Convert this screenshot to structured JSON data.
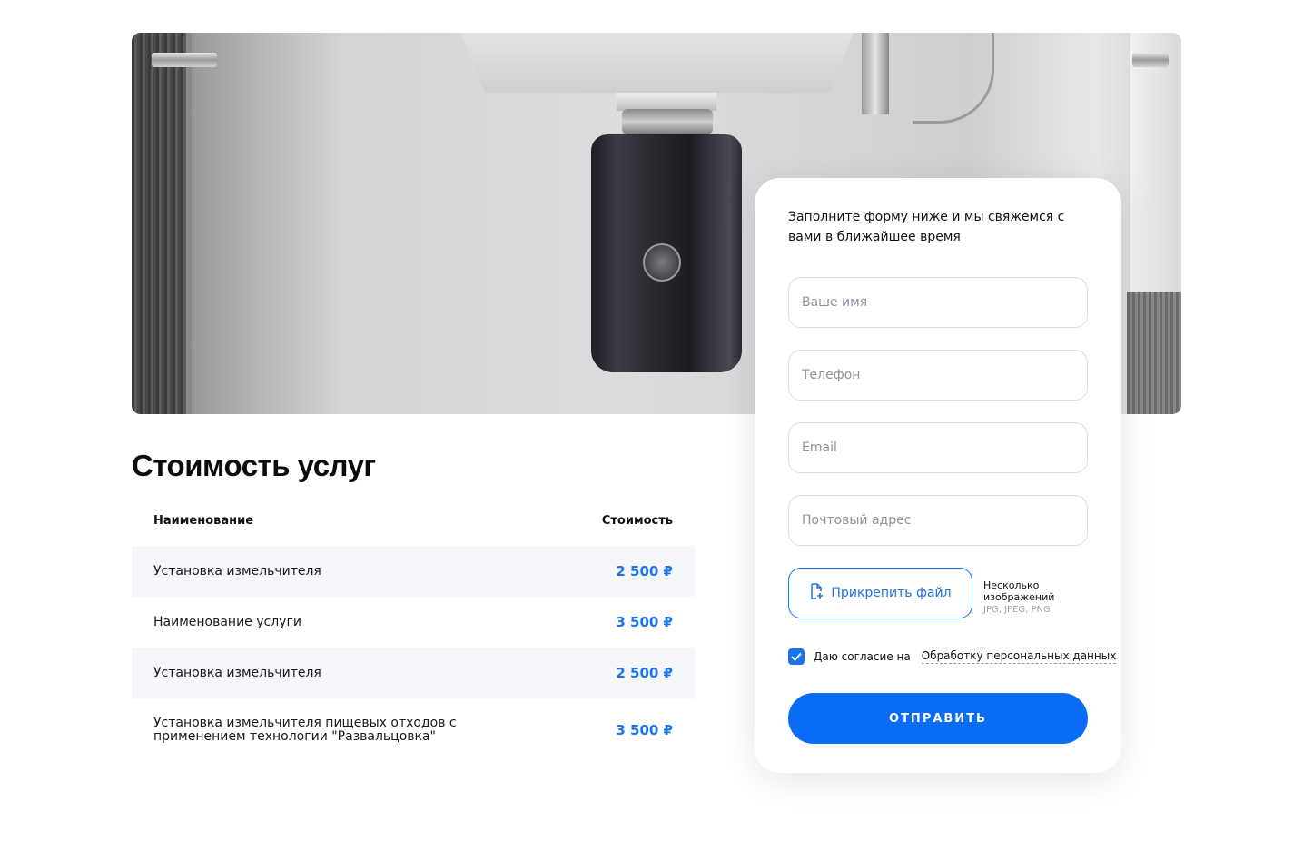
{
  "hero": {
    "image_alt": "food waste disposer under sink"
  },
  "pricing": {
    "title": "Стоимость услуг",
    "headers": {
      "name": "Наименование",
      "price": "Стоимость"
    },
    "rows": [
      {
        "name": "Установка измельчителя",
        "price": "2 500 ₽"
      },
      {
        "name": "Наименование услуги",
        "price": "3 500 ₽"
      },
      {
        "name": "Установка измельчителя",
        "price": "2 500 ₽"
      },
      {
        "name": "Установка измельчителя пищевых отходов с применением технологии \"Развальцовка\"",
        "price": "3 500 ₽"
      }
    ]
  },
  "form": {
    "intro": "Заполните форму ниже и мы свяжемся с вами в ближайшее время",
    "name_placeholder": "Ваше имя",
    "phone_placeholder": "Телефон",
    "email_placeholder": "Email",
    "address_placeholder": "Почтовый адрес",
    "attach_label": "Прикрепить файл",
    "attach_note": "Несколько изображений",
    "attach_types": "JPG, JPEG, PNG",
    "consent_text": "Даю согласие на",
    "consent_link": "Обработку персональных данных",
    "submit_label": "ОТПРАВИТЬ"
  },
  "colors": {
    "accent": "#0a6cf5",
    "price": "#1a73e8",
    "row_alt": "#f5f6fa"
  }
}
